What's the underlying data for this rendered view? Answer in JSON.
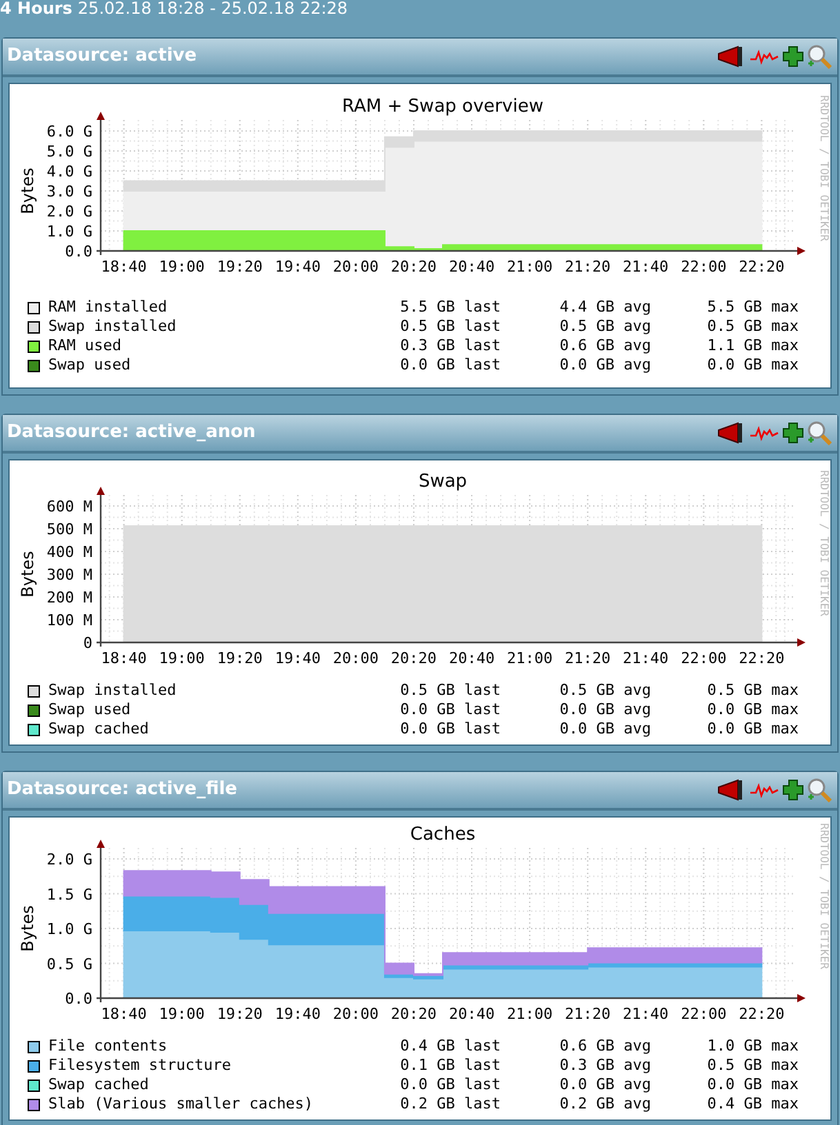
{
  "period": {
    "label": "4 Hours",
    "range": "25.02.18 18:28 - 25.02.18 22:28"
  },
  "panels": [
    {
      "title": "Datasource: active",
      "credit": "RRDTOOL / TOBI OETIKER",
      "chart_data": {
        "type": "area",
        "title": "RAM + Swap overview",
        "ylabel": "Bytes",
        "stacked": false,
        "grid": true,
        "categories": [
          "18:40",
          null,
          "19:00",
          null,
          "19:20",
          null,
          "19:40",
          null,
          "20:00",
          null,
          "20:20",
          null,
          "20:40",
          null,
          "21:00",
          null,
          "21:20",
          null,
          "21:40",
          null,
          "22:00",
          null,
          "22:20"
        ],
        "ylim": [
          0,
          6
        ],
        "yticks": [
          {
            "value": 0,
            "label": "0.0"
          },
          {
            "value": 1,
            "label": "1.0 G"
          },
          {
            "value": 2,
            "label": "2.0 G"
          },
          {
            "value": 3,
            "label": "3.0 G"
          },
          {
            "value": 4,
            "label": "4.0 G"
          },
          {
            "value": 5,
            "label": "5.0 G"
          },
          {
            "value": 6,
            "label": "6.0 G"
          }
        ],
        "series": [
          {
            "name": "RAM installed",
            "color": "#efefef",
            "values": [
              3,
              3,
              3,
              3,
              3,
              3,
              3,
              3,
              3,
              5.2,
              5.5,
              5.5,
              5.5,
              5.5,
              5.5,
              5.5,
              5.5,
              5.5,
              5.5,
              5.5,
              5.5,
              5.5,
              5.5
            ]
          },
          {
            "name": "Swap installed",
            "color": "#dcdcdc",
            "values": [
              3.5,
              3.5,
              3.5,
              3.5,
              3.5,
              3.5,
              3.5,
              3.5,
              3.5,
              5.7,
              6,
              6,
              6,
              6,
              6,
              6,
              6,
              6,
              6,
              6,
              6,
              6,
              6
            ]
          },
          {
            "name": "RAM used",
            "color": "#80f040",
            "values": [
              1,
              1,
              1,
              1,
              1,
              1,
              1,
              1,
              1,
              0.2,
              0.1,
              0.3,
              0.3,
              0.3,
              0.3,
              0.3,
              0.3,
              0.3,
              0.3,
              0.3,
              0.3,
              0.3,
              0.3
            ]
          },
          {
            "name": "Swap used",
            "color": "#3a8a1c",
            "values": [
              null,
              null,
              null,
              null,
              null,
              null,
              null,
              null,
              null,
              null,
              null,
              null,
              null,
              null,
              null,
              null,
              null,
              null,
              null,
              null,
              null,
              null,
              null
            ]
          }
        ]
      },
      "legend": [
        {
          "last": "5.5 GB last",
          "avg": "4.4 GB avg",
          "max": "5.5 GB max"
        },
        {
          "last": "0.5 GB last",
          "avg": "0.5 GB avg",
          "max": "0.5 GB max"
        },
        {
          "last": "0.3 GB last",
          "avg": "0.6 GB avg",
          "max": "1.1 GB max"
        },
        {
          "last": "0.0 GB last",
          "avg": "0.0 GB avg",
          "max": "0.0 GB max"
        }
      ]
    },
    {
      "title": "Datasource: active_anon",
      "credit": "RRDTOOL / TOBI OETIKER",
      "chart_data": {
        "type": "area",
        "title": "Swap",
        "ylabel": "Bytes",
        "stacked": false,
        "grid": true,
        "categories": [
          "18:40",
          null,
          "19:00",
          null,
          "19:20",
          null,
          "19:40",
          null,
          "20:00",
          null,
          "20:20",
          null,
          "20:40",
          null,
          "21:00",
          null,
          "21:20",
          null,
          "21:40",
          null,
          "22:00",
          null,
          "22:20"
        ],
        "ylim": [
          0,
          600
        ],
        "yticks": [
          {
            "value": 0,
            "label": "0"
          },
          {
            "value": 100,
            "label": "100 M"
          },
          {
            "value": 200,
            "label": "200 M"
          },
          {
            "value": 300,
            "label": "300 M"
          },
          {
            "value": 400,
            "label": "400 M"
          },
          {
            "value": 500,
            "label": "500 M"
          },
          {
            "value": 600,
            "label": "600 M"
          }
        ],
        "series": [
          {
            "name": "Swap installed",
            "color": "#dddddd",
            "values": [
              512,
              512,
              512,
              512,
              512,
              512,
              512,
              512,
              512,
              512,
              512,
              512,
              512,
              512,
              512,
              512,
              512,
              512,
              512,
              512,
              512,
              512,
              512
            ]
          },
          {
            "name": "Swap used",
            "color": "#3a8a1c",
            "values": [
              null,
              null,
              null,
              null,
              null,
              null,
              null,
              null,
              null,
              null,
              null,
              null,
              null,
              null,
              null,
              null,
              null,
              null,
              null,
              null,
              null,
              null,
              null
            ]
          },
          {
            "name": "Swap cached",
            "color": "#5fe8cc",
            "values": [
              null,
              null,
              null,
              null,
              null,
              null,
              null,
              null,
              null,
              null,
              null,
              null,
              null,
              null,
              null,
              null,
              null,
              null,
              null,
              null,
              null,
              null,
              null
            ]
          }
        ]
      },
      "legend": [
        {
          "last": "0.5 GB last",
          "avg": "0.5 GB avg",
          "max": "0.5 GB max"
        },
        {
          "last": "0.0 GB last",
          "avg": "0.0 GB avg",
          "max": "0.0 GB max"
        },
        {
          "last": "0.0 GB last",
          "avg": "0.0 GB avg",
          "max": "0.0 GB max"
        }
      ]
    },
    {
      "title": "Datasource: active_file",
      "credit": "RRDTOOL / TOBI OETIKER",
      "chart_data": {
        "type": "area",
        "title": "Caches",
        "ylabel": "Bytes",
        "stacked": true,
        "grid": true,
        "categories": [
          "18:40",
          null,
          "19:00",
          null,
          "19:20",
          null,
          "19:40",
          null,
          "20:00",
          null,
          "20:20",
          null,
          "20:40",
          null,
          "21:00",
          null,
          "21:20",
          null,
          "21:40",
          null,
          "22:00",
          null,
          "22:20"
        ],
        "ylim": [
          0,
          2
        ],
        "yticks": [
          {
            "value": 0,
            "label": "0.0"
          },
          {
            "value": 0.5,
            "label": "0.5 G"
          },
          {
            "value": 1,
            "label": "1.0 G"
          },
          {
            "value": 1.5,
            "label": "1.5 G"
          },
          {
            "value": 2,
            "label": "2.0 G"
          }
        ],
        "series": [
          {
            "name": "File contents",
            "color": "#8ecbec",
            "values": [
              0.97,
              0.97,
              0.97,
              0.95,
              0.85,
              0.77,
              0.77,
              0.77,
              0.77,
              0.3,
              0.28,
              0.42,
              0.42,
              0.42,
              0.42,
              0.42,
              0.45,
              0.45,
              0.45,
              0.45,
              0.45,
              0.45,
              0.45
            ]
          },
          {
            "name": "Filesystem structure",
            "color": "#4aaee8",
            "values": [
              0.5,
              0.5,
              0.5,
              0.5,
              0.5,
              0.45,
              0.45,
              0.45,
              0.45,
              0.05,
              0.05,
              0.06,
              0.06,
              0.06,
              0.06,
              0.06,
              0.06,
              0.06,
              0.06,
              0.06,
              0.06,
              0.06,
              0.06
            ]
          },
          {
            "name": "Swap cached",
            "color": "#5fe8cc",
            "values": [
              null,
              null,
              null,
              null,
              null,
              null,
              null,
              null,
              null,
              null,
              null,
              null,
              null,
              null,
              null,
              null,
              null,
              null,
              null,
              null,
              null,
              null,
              null
            ]
          },
          {
            "name": "Slab (Various smaller caches)",
            "color": "#b08be8",
            "values": [
              0.36,
              0.36,
              0.36,
              0.36,
              0.35,
              0.38,
              0.38,
              0.38,
              0.38,
              0.15,
              0.02,
              0.17,
              0.17,
              0.17,
              0.17,
              0.17,
              0.21,
              0.21,
              0.21,
              0.21,
              0.21,
              0.21,
              0.21
            ]
          }
        ]
      },
      "legend": [
        {
          "last": "0.4 GB last",
          "avg": "0.6 GB avg",
          "max": "1.0 GB max"
        },
        {
          "last": "0.1 GB last",
          "avg": "0.3 GB avg",
          "max": "0.5 GB max"
        },
        {
          "last": "0.0 GB last",
          "avg": "0.0 GB avg",
          "max": "0.0 GB max"
        },
        {
          "last": "0.2 GB last",
          "avg": "0.2 GB avg",
          "max": "0.4 GB max"
        }
      ]
    }
  ]
}
